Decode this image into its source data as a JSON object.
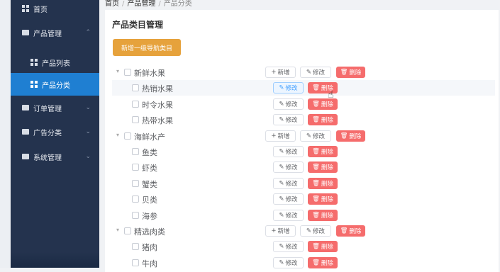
{
  "breadcrumb": {
    "home": "首页",
    "sep": "/",
    "section": "产品管理",
    "page": "产品分类"
  },
  "sidebar": {
    "items": [
      {
        "label": "首页",
        "icon": "grid-icon"
      },
      {
        "label": "产品管理",
        "icon": "bag-icon",
        "chevron": "⌃"
      },
      {
        "label": "产品列表",
        "icon": "grid-icon"
      },
      {
        "label": "产品分类",
        "icon": "grid-icon"
      },
      {
        "label": "订单管理",
        "icon": "bag-icon",
        "chevron": "⌄"
      },
      {
        "label": "广告分类",
        "icon": "bag-icon",
        "chevron": "⌄"
      },
      {
        "label": "系统管理",
        "icon": "bag-icon",
        "chevron": "⌄"
      }
    ]
  },
  "card": {
    "title": "产品类目管理",
    "add_root_label": "新增一级导航类目"
  },
  "buttons": {
    "add": "新增",
    "edit": "修改",
    "delete": "删除"
  },
  "tree": [
    {
      "label": "新鲜水果",
      "level": 1
    },
    {
      "label": "热销水果",
      "level": 2
    },
    {
      "label": "时令水果",
      "level": 2
    },
    {
      "label": "热带水果",
      "level": 2
    },
    {
      "label": "海鲜水产",
      "level": 1
    },
    {
      "label": "鱼类",
      "level": 2
    },
    {
      "label": "虾类",
      "level": 2
    },
    {
      "label": "蟹类",
      "level": 2
    },
    {
      "label": "贝类",
      "level": 2
    },
    {
      "label": "海参",
      "level": 2
    },
    {
      "label": "精选肉类",
      "level": 1
    },
    {
      "label": "猪肉",
      "level": 2
    },
    {
      "label": "牛肉",
      "level": 2
    }
  ],
  "colors": {
    "sidebar": "#24334e",
    "active": "#1f7fd2",
    "warning": "#e6a23c",
    "danger": "#f56c6c"
  }
}
